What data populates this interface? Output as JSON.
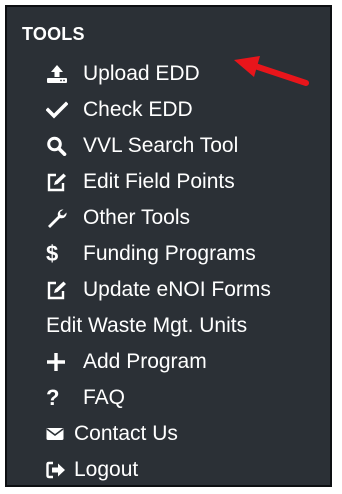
{
  "section": {
    "title": "TOOLS"
  },
  "menu": {
    "items": [
      {
        "label": "Upload EDD",
        "icon": "upload-icon"
      },
      {
        "label": "Check EDD",
        "icon": "check-icon"
      },
      {
        "label": "VVL Search Tool",
        "icon": "search-icon"
      },
      {
        "label": "Edit Field Points",
        "icon": "edit-icon"
      },
      {
        "label": "Other Tools",
        "icon": "wrench-icon"
      },
      {
        "label": "Funding Programs",
        "icon": "dollar-icon",
        "icon_glyph": "$"
      },
      {
        "label": "Update eNOI Forms",
        "icon": "edit-icon"
      },
      {
        "label": "Edit Waste Mgt. Units",
        "icon": ""
      },
      {
        "label": "Add Program",
        "icon": "plus-icon"
      },
      {
        "label": "FAQ",
        "icon": "question-icon",
        "icon_glyph": "?"
      },
      {
        "label": "Contact Us",
        "icon": "envelope-icon"
      },
      {
        "label": "Logout",
        "icon": "sign-out-icon"
      }
    ]
  },
  "annotation": {
    "icon": "red-arrow-icon"
  },
  "colors": {
    "panel_bg": "#2b3036",
    "text": "#ffffff",
    "arrow": "#e8151b"
  }
}
